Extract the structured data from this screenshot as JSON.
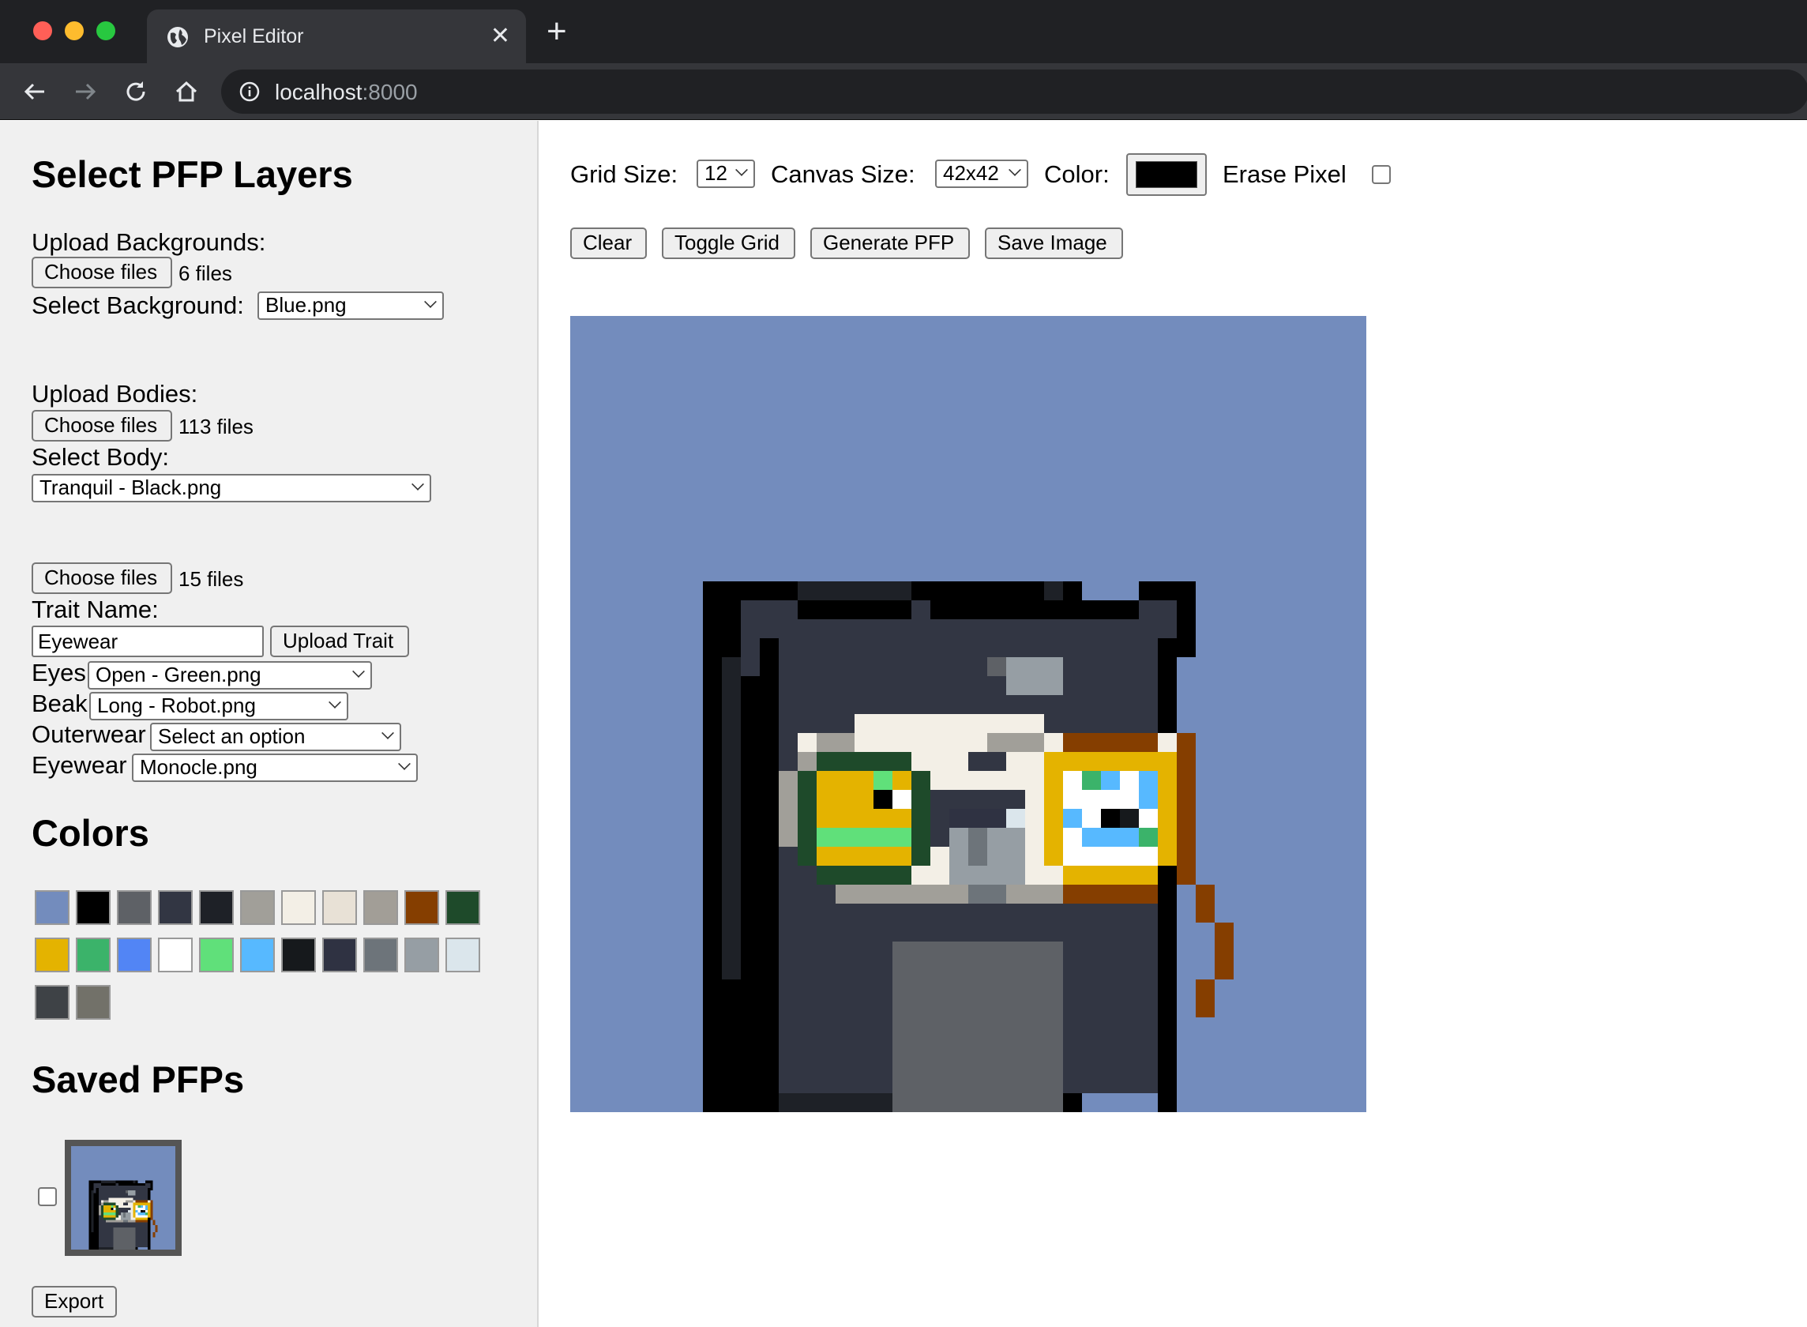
{
  "browser": {
    "tab_title": "Pixel Editor",
    "url_host": "localhost",
    "url_port": ":8000"
  },
  "sidebar": {
    "title": "Select PFP Layers",
    "backgrounds": {
      "upload_label": "Upload Backgrounds:",
      "choose_label": "Choose files",
      "file_count": "6 files",
      "select_label": "Select Background:",
      "selected": "Blue.png"
    },
    "bodies": {
      "upload_label": "Upload Bodies:",
      "choose_label": "Choose files",
      "file_count": "113 files",
      "select_label": "Select Body:",
      "selected": "Tranquil - Black.png"
    },
    "trait_upload": {
      "choose_label": "Choose files",
      "file_count": "15 files",
      "name_label": "Trait Name:",
      "name_value": "Eyewear",
      "upload_button": "Upload Trait"
    },
    "traits": [
      {
        "label": "Eyes",
        "selected": "Open - Green.png"
      },
      {
        "label": "Beak",
        "selected": "Long - Robot.png"
      },
      {
        "label": "Outerwear",
        "selected": "Select an option"
      },
      {
        "label": "Eyewear",
        "selected": "Monocle.png"
      }
    ],
    "colors_title": "Colors",
    "colors": [
      "#738cbd",
      "#000000",
      "#5e6166",
      "#323643",
      "#1e2127",
      "#a19f99",
      "#f3efe6",
      "#e8e1d6",
      "#a29e97",
      "#853e00",
      "#1e4a2a",
      "#e4b300",
      "#3bb36a",
      "#5285f5",
      "#ffffff",
      "#60e07a",
      "#57b9ff",
      "#16191c",
      "#2f3242",
      "#6d747a",
      "#969ea4",
      "#dbe6ec",
      "#3e4246",
      "#727169"
    ],
    "saved_title": "Saved PFPs",
    "export_label": "Export"
  },
  "main": {
    "grid_size_label": "Grid Size:",
    "grid_size_value": "12",
    "canvas_size_label": "Canvas Size:",
    "canvas_size_value": "42x42",
    "color_label": "Color:",
    "color_value": "#000000",
    "erase_label": "Erase Pixel",
    "buttons": {
      "clear": "Clear",
      "toggle_grid": "Toggle Grid",
      "generate": "Generate PFP",
      "save": "Save Image"
    }
  }
}
